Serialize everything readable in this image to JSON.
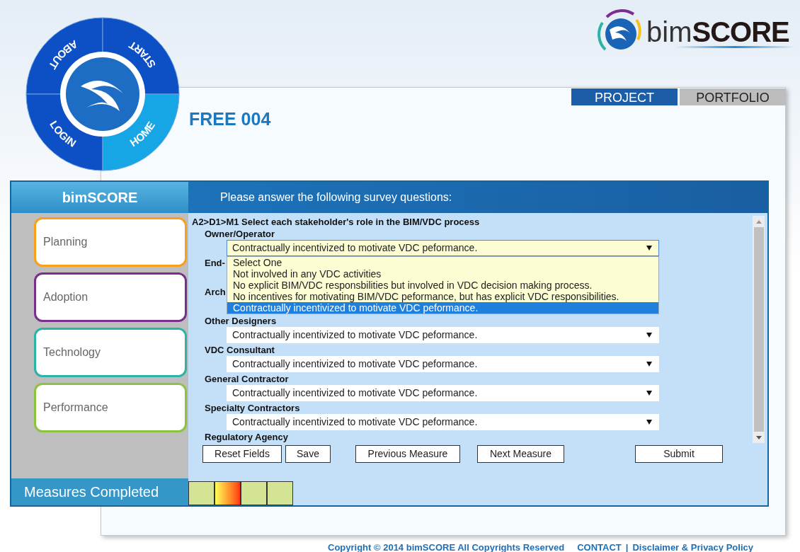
{
  "wheel_menu": [
    {
      "label": "ABOUT",
      "selected": false
    },
    {
      "label": "START",
      "selected": false
    },
    {
      "label": "LOGIN",
      "selected": false
    },
    {
      "label": "HOME",
      "selected": true
    }
  ],
  "brand": {
    "light": "bim",
    "bold": "SCORE"
  },
  "tabs": [
    {
      "label": "PROJECT",
      "selected": true
    },
    {
      "label": "PORTFOLIO",
      "selected": false
    }
  ],
  "project_title": "FREE 004",
  "panel": {
    "title": "bimSCORE",
    "instruction": "Please answer the following survey questions:"
  },
  "categories": [
    {
      "label": "Planning",
      "color": "#f7a01c"
    },
    {
      "label": "Adoption",
      "color": "#7a2e8e"
    },
    {
      "label": "Technology",
      "color": "#2bb3a6"
    },
    {
      "label": "Performance",
      "color": "#8bc43f"
    }
  ],
  "question": "A2>D1>M1 Select each stakeholder's role in the BIM/VDC process",
  "stakeholders": [
    {
      "label": "Owner/Operator",
      "value": "Contractually incentivized to motivate VDC peformance.",
      "expanded": true
    },
    {
      "label": "End-"
    },
    {
      "label": "Arch"
    },
    {
      "label": "Other Designers",
      "value": "Contractually incentivized to motivate VDC peformance.",
      "expanded": false
    },
    {
      "label": "VDC Consultant",
      "value": "Contractually incentivized to motivate VDC peformance.",
      "expanded": false
    },
    {
      "label": "General Contractor",
      "value": "Contractually incentivized to motivate VDC peformance.",
      "expanded": false
    },
    {
      "label": "Specialty Contractors",
      "value": "Contractually incentivized to motivate VDC peformance.",
      "expanded": false
    },
    {
      "label": "Regulatory Agency"
    }
  ],
  "dropdown_options": [
    {
      "label": "Select One",
      "selected": false
    },
    {
      "label": "Not involved in any VDC activities",
      "selected": false
    },
    {
      "label": "No explicit BIM/VDC responsbilities but involved in VDC decision making process.",
      "selected": false
    },
    {
      "label": "No incentives for motivating BIM/VDC peformance, but has explicit VDC responsibilities.",
      "selected": false
    },
    {
      "label": "Contractually incentivized to motivate VDC peformance.",
      "selected": true
    }
  ],
  "buttons": [
    {
      "label": "Reset Fields"
    },
    {
      "label": "Save"
    },
    {
      "label": "Previous Measure"
    },
    {
      "label": "Next Measure"
    },
    {
      "label": "Submit"
    }
  ],
  "measures_label": "Measures Completed",
  "measures": [
    {
      "kind": "done"
    },
    {
      "kind": "current"
    },
    {
      "kind": "done"
    },
    {
      "kind": "done"
    }
  ],
  "footer": {
    "copyright": "Copyright © 2014 bimSCORE All Copyrights Reserved",
    "links": [
      "CONTACT",
      "Disclaimer & Privacy Policy"
    ],
    "separator": "|"
  }
}
